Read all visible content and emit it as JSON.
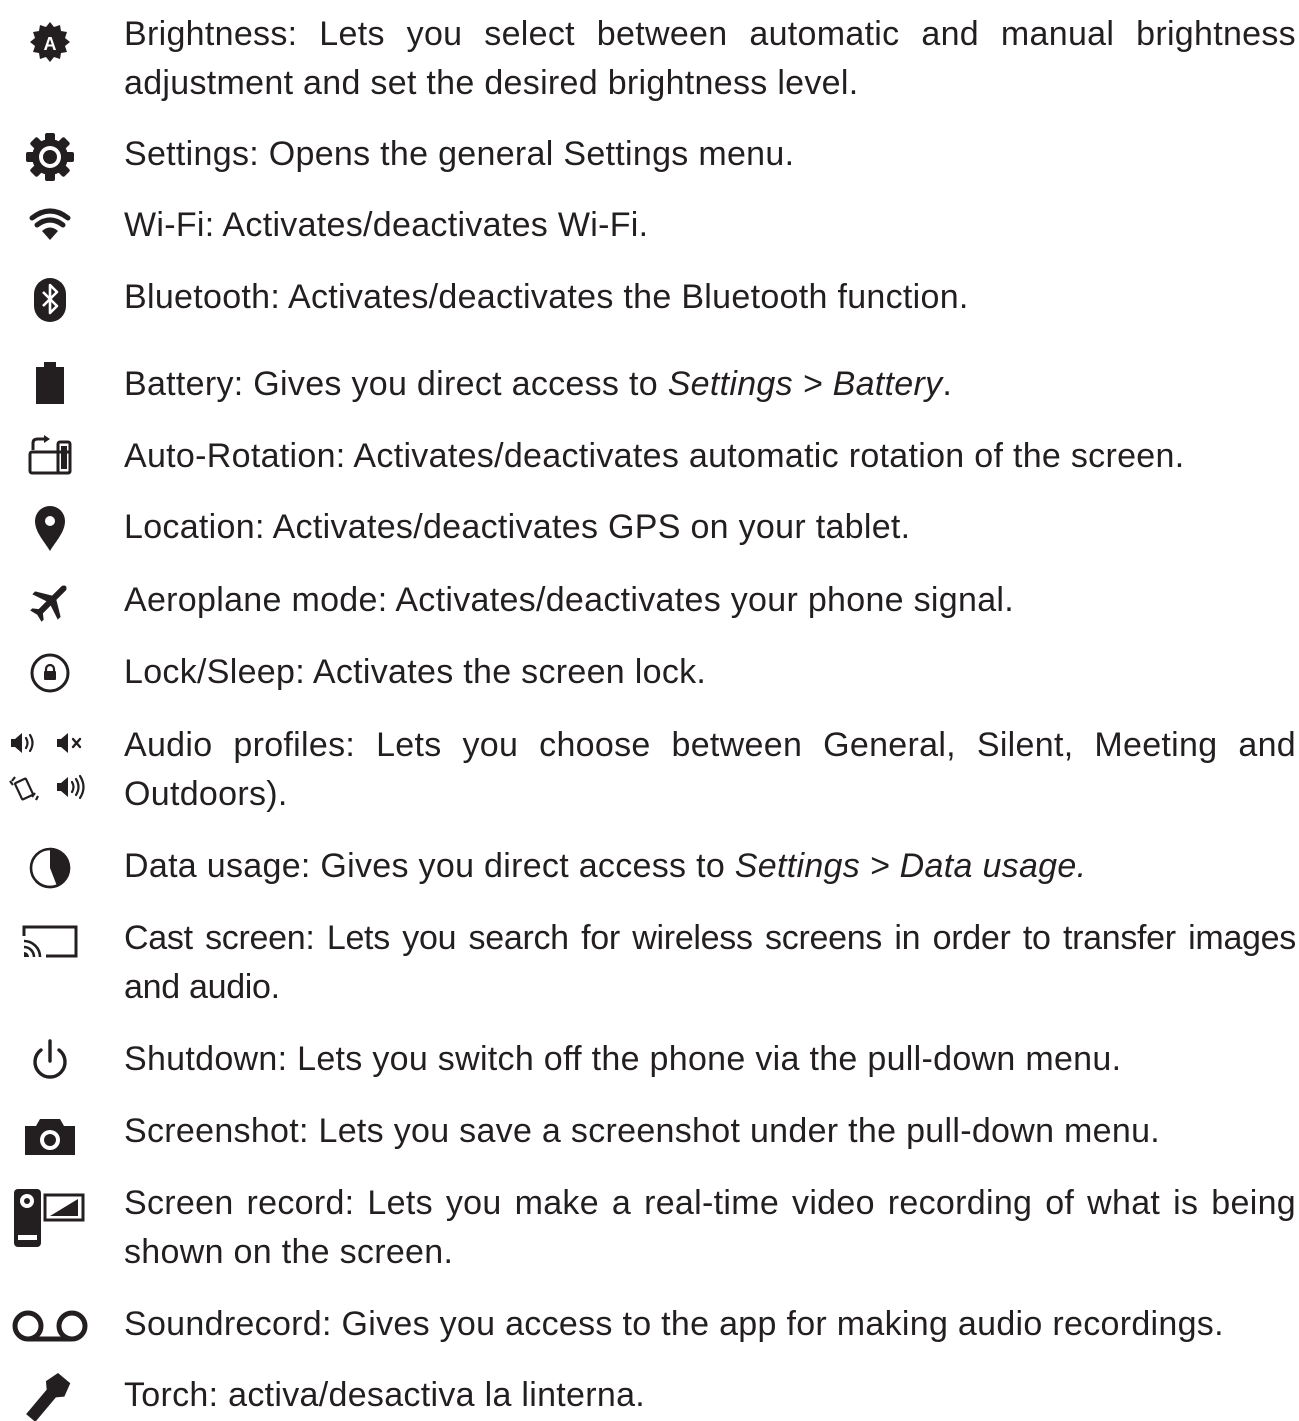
{
  "items": [
    {
      "icon": "brightness-icon",
      "label": "Brightness:",
      "desc": " Lets you select between automatic and manual brightness adjustment and set the desired brightness level."
    },
    {
      "icon": "settings-icon",
      "label": "Settings:",
      "desc": " Opens the general Settings menu."
    },
    {
      "icon": "wifi-icon",
      "label": "Wi-Fi:",
      "desc": " Activates/deactivates Wi-Fi."
    },
    {
      "icon": "bluetooth-icon",
      "label": "Bluetooth:",
      "desc": " Activates/deactivates the Bluetooth function."
    },
    {
      "icon": "battery-icon",
      "label": "Battery:",
      "desc": " Gives you direct access to ",
      "emph": "Settings > Battery",
      "tail": "."
    },
    {
      "icon": "auto-rotation-icon",
      "label": "Auto-Rotation:",
      "desc": " Activates/deactivates automatic rotation of the screen."
    },
    {
      "icon": "location-icon",
      "label": "Location:",
      "desc": " Activates/deactivates GPS on your tablet."
    },
    {
      "icon": "aeroplane-icon",
      "label": "Aeroplane mode:",
      "desc": " Activates/deactivates your phone signal."
    },
    {
      "icon": "lock-icon",
      "label": "Lock/Sleep:",
      "desc": " Activates the screen lock."
    },
    {
      "icon": "audio-profiles-icon",
      "label": "Audio profiles:",
      "desc": " Lets you choose between ",
      "b1": "General, Silent, Meeting",
      "mid": " and ",
      "b2": "Outdoors",
      "tail": ")."
    },
    {
      "icon": "data-usage-icon",
      "label": "Data usage:",
      "desc": " Gives you direct access to ",
      "emph": "Settings > Data usage.",
      "tail": ""
    },
    {
      "icon": "cast-screen-icon",
      "label": "Cast screen:",
      "desc": " Lets you search for wireless screens in order to transfer images and audio."
    },
    {
      "icon": "shutdown-icon",
      "label": "Shutdown",
      "desc": ": Lets you switch off the phone via the pull-down menu."
    },
    {
      "icon": "screenshot-icon",
      "label": "Screenshot:",
      "desc": " Lets you save a screenshot under the pull-down menu."
    },
    {
      "icon": "screen-record-icon",
      "label": "Screen record:",
      "desc": " Lets you make a real-time video recording of what is being shown on the screen."
    },
    {
      "icon": "soundrecord-icon",
      "label": "Soundrecord:",
      "desc": " Gives you access to the app for making audio recordings."
    },
    {
      "icon": "torch-icon",
      "label": "Torch:",
      "desc": " activa/desactiva la linterna."
    }
  ]
}
